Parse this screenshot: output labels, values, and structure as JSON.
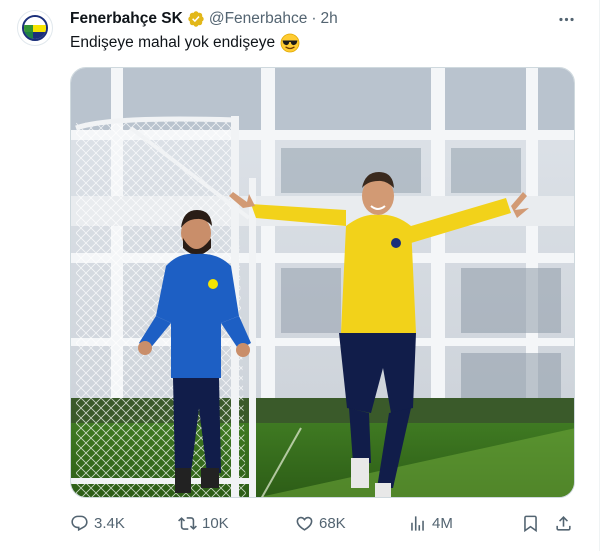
{
  "tweet": {
    "display_name": "Fenerbahçe SK",
    "handle": "@Fenerbahce",
    "separator": "·",
    "time": "2h",
    "text": "Endişeye mahal yok endişeye",
    "emoji": "smiling-face-with-sunglasses",
    "verified": true
  },
  "actions": {
    "replies": "3.4K",
    "retweets": "10K",
    "likes": "68K",
    "views": "4M"
  },
  "colors": {
    "brand_blue": "#1b2f7a",
    "brand_yellow": "#f5e400",
    "verified_gold": "#e2b719",
    "muted_text": "#536471"
  }
}
